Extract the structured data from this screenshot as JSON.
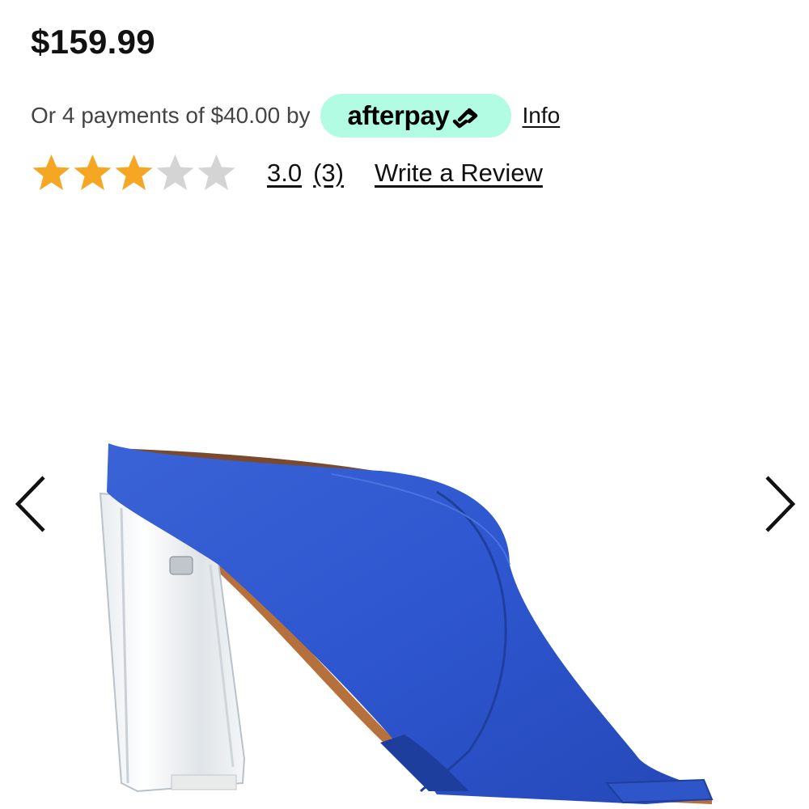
{
  "product": {
    "price": "$159.99",
    "image_alt": "Blue leather mule with clear block heel"
  },
  "afterpay": {
    "text": "Or 4 payments of $40.00 by",
    "brand": "afterpay",
    "info_label": "Info",
    "badge_color": "#b2fce4"
  },
  "rating": {
    "value": "3.0",
    "count": "(3)",
    "stars_filled": 3,
    "stars_total": 5,
    "write_review_label": "Write a Review",
    "filled_color": "#f5a623",
    "empty_color": "#d4d4d4"
  },
  "carousel": {
    "prev_icon": "chevron-left-icon",
    "next_icon": "chevron-right-icon"
  }
}
